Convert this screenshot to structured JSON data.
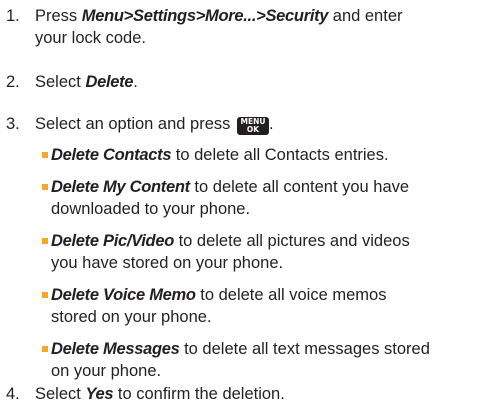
{
  "steps": [
    {
      "number": "1.",
      "pre": "Press ",
      "path": [
        "Menu",
        "Settings",
        "More...",
        "Security"
      ],
      "sep": ">",
      "post_line1": " and enter",
      "post_line2": "your lock code."
    },
    {
      "number": "2.",
      "pre": "Select ",
      "em": "Delete",
      "post": "."
    },
    {
      "number": "3.",
      "text": "Select an option and press ",
      "key": {
        "line1": "MENU",
        "line2": "OK",
        "icon": "menu-ok-key-icon"
      },
      "post": "."
    },
    {
      "number": "4.",
      "pre": "Select ",
      "em": "Yes",
      "post": " to confirm the deletion."
    }
  ],
  "options": [
    {
      "em": "Delete Contacts",
      "line1": " to delete all Contacts entries.",
      "line2": ""
    },
    {
      "em": "Delete My Content",
      "line1": " to delete all content you have",
      "line2": "downloaded to your phone."
    },
    {
      "em": "Delete Pic/Video",
      "line1": " to delete all pictures and videos",
      "line2": "you have stored on your phone."
    },
    {
      "em": "Delete Voice Memo",
      "line1": " to delete all voice memos",
      "line2": "stored on your phone."
    },
    {
      "em": "Delete Messages",
      "line1": " to delete all text messages stored",
      "line2": "on your phone."
    }
  ],
  "colors": {
    "text": "#231f20",
    "bullet": "#f7a823",
    "key_bg": "#231f20",
    "key_text": "#ffffff"
  }
}
